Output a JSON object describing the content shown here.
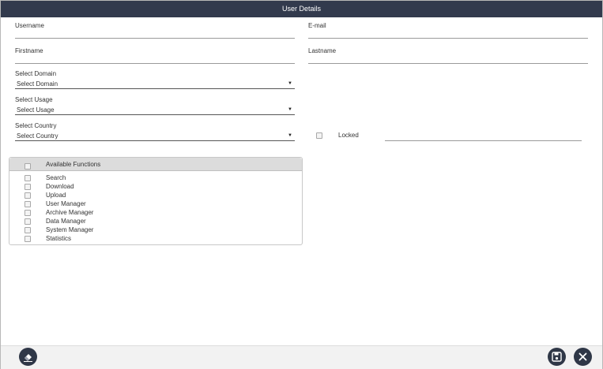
{
  "window": {
    "title": "User Details"
  },
  "form": {
    "username_label": "Username",
    "username_value": "",
    "email_label": "E-mail",
    "email_value": "",
    "firstname_label": "Firstname",
    "firstname_value": "",
    "lastname_label": "Lastname",
    "lastname_value": "",
    "domain_label": "Select Domain",
    "domain_value": "Select Domain",
    "usage_label": "Select Usage",
    "usage_value": "Select Usage",
    "country_label": "Select Country",
    "country_value": "Select Country",
    "locked_label": "Locked",
    "locked_checked": false,
    "locked_note_value": ""
  },
  "functions": {
    "header_label": "Available Functions",
    "select_all_checked": false,
    "items": [
      {
        "label": "Search",
        "checked": false
      },
      {
        "label": "Download",
        "checked": false
      },
      {
        "label": "Upload",
        "checked": false
      },
      {
        "label": "User Manager",
        "checked": false
      },
      {
        "label": "Archive Manager",
        "checked": false
      },
      {
        "label": "Data Manager",
        "checked": false
      },
      {
        "label": "System Manager",
        "checked": false
      },
      {
        "label": "Statistics",
        "checked": false
      }
    ]
  },
  "footer": {
    "icons": {
      "clear": "eraser-icon",
      "save": "floppy-disk-icon",
      "close": "close-icon"
    },
    "colors": {
      "button_bg": "#2f3747",
      "titlebar_bg": "#323a4d"
    }
  }
}
